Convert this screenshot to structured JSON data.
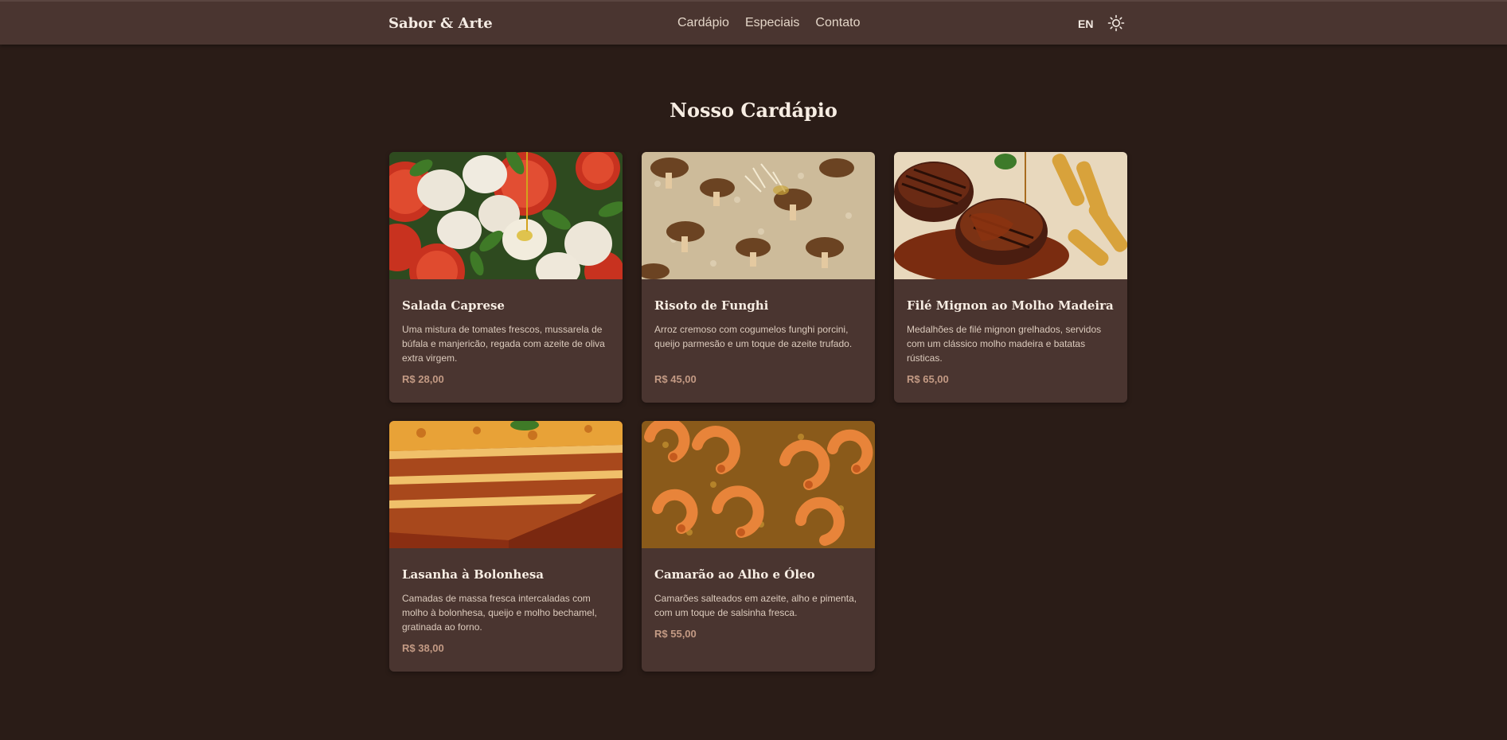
{
  "header": {
    "brand": "Sabor & Arte",
    "nav": [
      "Cardápio",
      "Especiais",
      "Contato"
    ],
    "lang": "EN",
    "theme_icon": "sun-icon"
  },
  "main": {
    "title": "Nosso Cardápio",
    "dishes": [
      {
        "name": "Salada Caprese",
        "description": "Uma mistura de tomates frescos, mussarela de búfala e manjericão, regada com azeite de oliva extra virgem.",
        "price": "R$ 28,00"
      },
      {
        "name": "Risoto de Funghi",
        "description": "Arroz cremoso com cogumelos funghi porcini, queijo parmesão e um toque de azeite trufado.",
        "price": "R$ 45,00"
      },
      {
        "name": "Filé Mignon ao Molho Madeira",
        "description": "Medalhões de filé mignon grelhados, servidos com um clássico molho madeira e batatas rústicas.",
        "price": "R$ 65,00"
      },
      {
        "name": "Lasanha à Bolonhesa",
        "description": "Camadas de massa fresca intercaladas com molho à bolonhesa, queijo e molho bechamel, gratinada ao forno.",
        "price": "R$ 38,00"
      },
      {
        "name": "Camarão ao Alho e Óleo",
        "description": "Camarões salteados em azeite, alho e pimenta, com um toque de salsinha fresca.",
        "price": "R$ 55,00"
      }
    ]
  },
  "colors": {
    "background": "#2a1c17",
    "header": "#4a3530",
    "card": "#4a3530",
    "price": "#c39a84"
  }
}
